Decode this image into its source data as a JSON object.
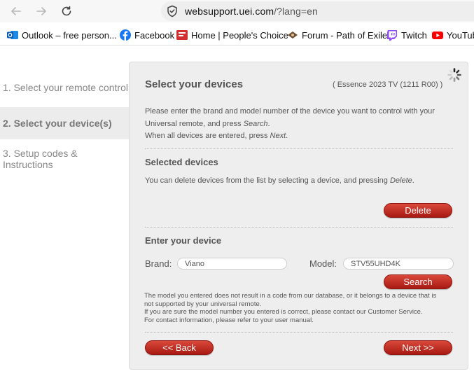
{
  "browser": {
    "url_domain": "websupport.uei.com",
    "url_path": "/?lang=en",
    "bookmarks": [
      {
        "label": "Outlook – free person...",
        "icon": "outlook-icon"
      },
      {
        "label": "Facebook",
        "icon": "facebook-icon"
      },
      {
        "label": "Home | People's Choice",
        "icon": "peoples-choice-icon"
      },
      {
        "label": "Forum - Path of Exile",
        "icon": "path-of-exile-icon"
      },
      {
        "label": "Twitch",
        "icon": "twitch-icon"
      },
      {
        "label": "YouTub",
        "icon": "youtube-icon"
      }
    ]
  },
  "sidebar": {
    "steps": [
      {
        "label": "1. Select your remote control"
      },
      {
        "label": "2. Select your device(s)"
      },
      {
        "label": "3. Setup codes & Instructions"
      }
    ]
  },
  "panel": {
    "title": "Select your devices",
    "remote_model": "( Essence 2023 TV (1211 R00) )",
    "instructions": {
      "line1": "Please enter the brand and model number of the device you want to control with your",
      "line2_prefix": "Universal remote, and press ",
      "line2_em": "Search",
      "line2_suffix": ".",
      "line3_prefix": "When all devices are entered, press ",
      "line3_em": "Next",
      "line3_suffix": "."
    },
    "selected": {
      "heading": "Selected devices",
      "note_prefix": "You can delete devices from the list by selecting a device, and pressing ",
      "note_em": "Delete",
      "note_suffix": ".",
      "delete_label": "Delete"
    },
    "enter": {
      "heading": "Enter your device",
      "brand_label": "Brand:",
      "brand_value": "Viano",
      "model_label": "Model:",
      "model_value": "STV55UHD4K",
      "search_label": "Search"
    },
    "message": {
      "line1": "The model you entered does not result in a code from our database, or it belongs to a device that is",
      "line2": "not supported by your universal remote.",
      "line3": "If you are sure the model number you entered is correct, please contact our Customer Service.",
      "line4": "For contact information, please refer to your user manual."
    },
    "back_label": "<< Back",
    "next_label": "Next >>"
  }
}
